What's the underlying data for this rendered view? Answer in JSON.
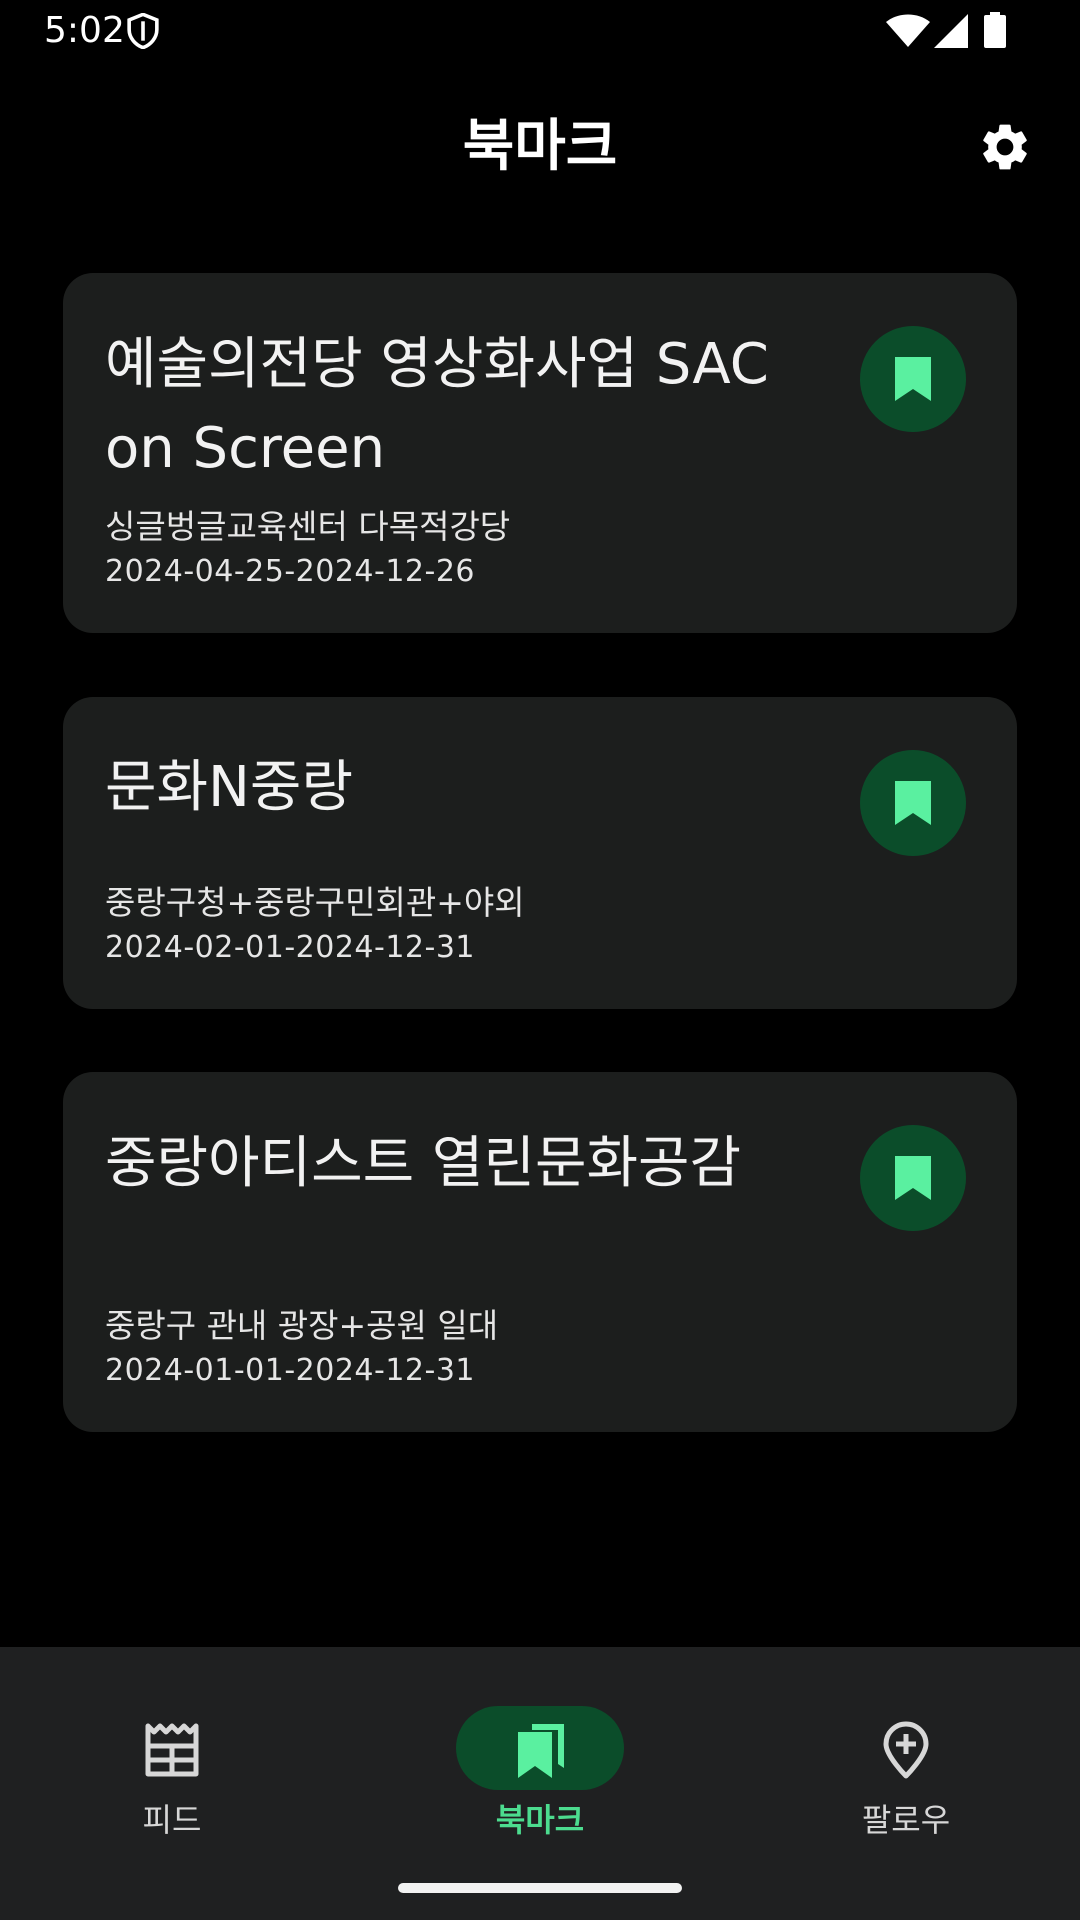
{
  "status_bar": {
    "time": "5:02",
    "icons": [
      "shield-icon",
      "wifi-icon",
      "signal-icon",
      "battery-icon"
    ]
  },
  "header": {
    "title": "북마크",
    "settings_icon": "gear-icon"
  },
  "cards": [
    {
      "title": "예술의전당 영상화사업 SAC on Screen",
      "place": "싱글벙글교육센터 다목적강당",
      "dates": "2024-04-25-2024-12-26",
      "bookmark_icon": "bookmark-icon"
    },
    {
      "title": "문화N중랑",
      "place": "중랑구청+중랑구민회관+야외",
      "dates": "2024-02-01-2024-12-31",
      "bookmark_icon": "bookmark-icon"
    },
    {
      "title": "중랑아티스트 열린문화공감",
      "place": "중랑구 관내 광장+공원 일대",
      "dates": "2024-01-01-2024-12-31",
      "bookmark_icon": "bookmark-icon"
    }
  ],
  "bottom_nav": {
    "items": [
      {
        "label": "피드",
        "icon": "feed-icon",
        "active": false
      },
      {
        "label": "북마크",
        "icon": "bookmarks-icon",
        "active": true
      },
      {
        "label": "팔로우",
        "icon": "location-add-icon",
        "active": false
      }
    ]
  },
  "colors": {
    "background": "#000000",
    "card": "#1c1e1d",
    "accent": "#4cdc8f",
    "accent_container": "#0b4d2a",
    "bookmark_icon": "#5af0a0",
    "nav_bar": "#1f2021"
  }
}
